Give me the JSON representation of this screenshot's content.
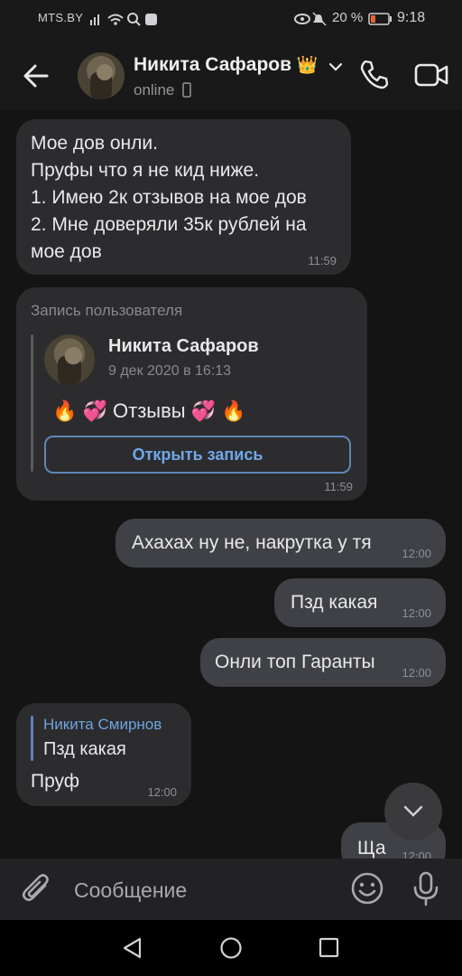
{
  "status_bar": {
    "carrier": "MTS.BY",
    "battery_percent": "20 %",
    "time": "9:18"
  },
  "header": {
    "contact_name": "Никита Сафаров",
    "contact_emoji": "👑",
    "presence": "online",
    "icons": [
      "back-arrow-icon",
      "chevron-down-icon",
      "phone-icon",
      "video-call-icon",
      "mobile-device-icon"
    ]
  },
  "messages": [
    {
      "direction": "incoming",
      "lines": [
        "Мое дов онли.",
        "Пруфы что я не кид ниже.",
        "1. Имею 2к отзывов на мое дов",
        "2. Мне доверяли 35к рублей на",
        "мое дов"
      ],
      "time": "11:59"
    },
    {
      "direction": "incoming",
      "type": "wall_post",
      "label": "Запись пользователя",
      "author": "Никита Сафаров",
      "date": "9 дек 2020 в 16:13",
      "text": "🔥 💞 Отзывы 💞 🔥",
      "button": "Открыть запись",
      "time": "11:59"
    },
    {
      "direction": "outgoing",
      "text": "Ахахах ну не, накрутка у тя",
      "time": "12:00"
    },
    {
      "direction": "outgoing",
      "text": "Пзд какая",
      "time": "12:00"
    },
    {
      "direction": "outgoing",
      "text": "Онли топ Гаранты",
      "time": "12:00"
    },
    {
      "direction": "incoming",
      "reply_to": {
        "author": "Никита Смирнов",
        "text": "Пзд какая"
      },
      "text": "Пруф",
      "time": "12:00"
    },
    {
      "direction": "outgoing",
      "text": "Ща",
      "time": "12:00"
    }
  ],
  "composer": {
    "placeholder": "Сообщение",
    "icons": [
      "attach-icon",
      "emoji-icon",
      "microphone-icon"
    ]
  },
  "navigation": {
    "icons": [
      "nav-back-icon",
      "nav-home-icon",
      "nav-recents-icon"
    ]
  },
  "colors": {
    "link": "#71a7e8",
    "reply_author": "#6fa3e0"
  }
}
